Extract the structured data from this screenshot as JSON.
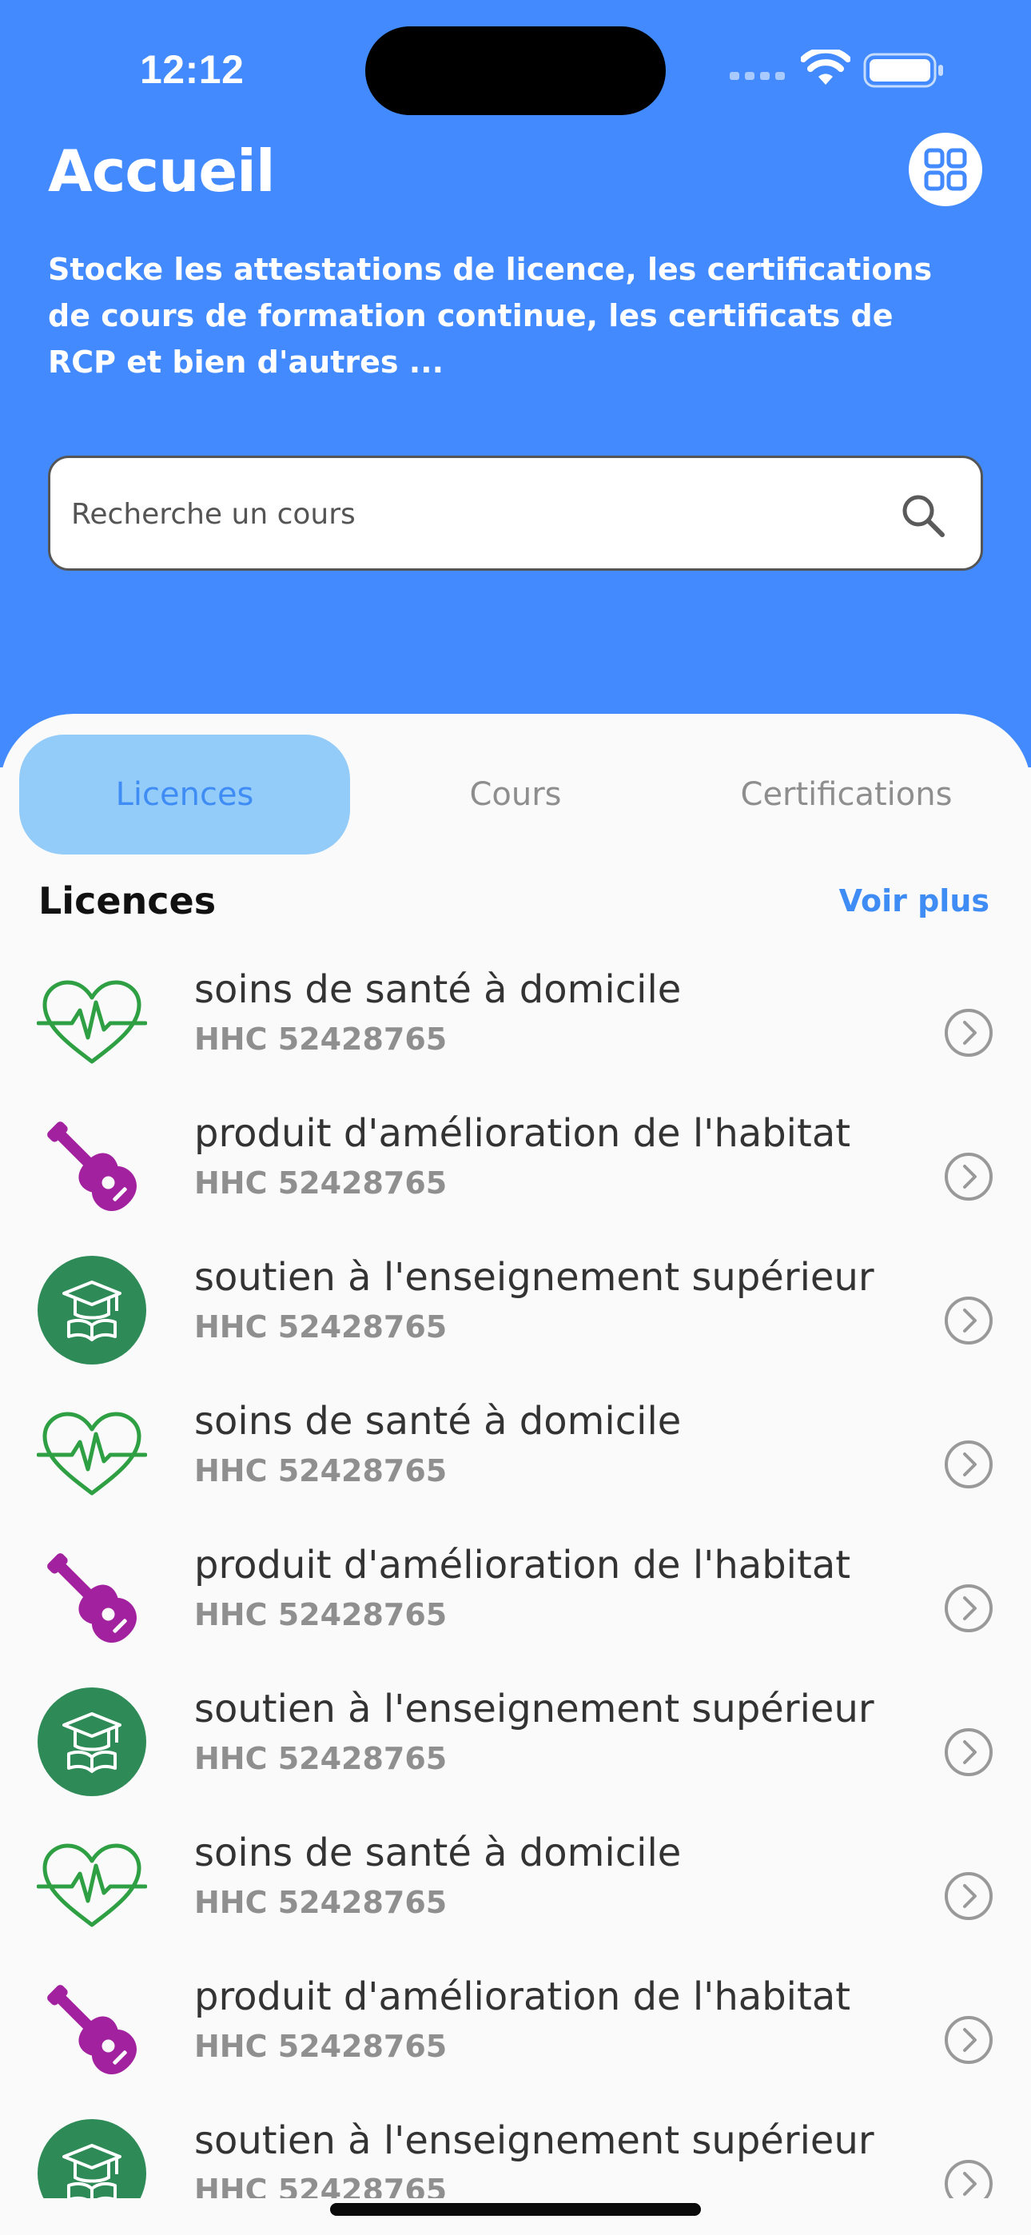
{
  "status_bar": {
    "time": "12:12"
  },
  "header": {
    "title": "Accueil",
    "description": "Stocke les attestations de licence, les certifications de cours de formation continue, les certificats de RCP et bien d'autres ..."
  },
  "search": {
    "placeholder": "Recherche un cours"
  },
  "tabs": [
    {
      "label": "Licences",
      "active": true
    },
    {
      "label": "Cours",
      "active": false
    },
    {
      "label": "Certifications",
      "active": false
    }
  ],
  "section": {
    "title": "Licences",
    "see_more": "Voir plus"
  },
  "items": [
    {
      "title": "soins de santé à domicile",
      "code": "HHC 52428765",
      "icon": "heart-pulse-icon"
    },
    {
      "title": "produit d'amélioration de l'habitat",
      "code": "HHC 52428765",
      "icon": "guitar-icon"
    },
    {
      "title": "soutien à l'enseignement supérieur",
      "code": "HHC 52428765",
      "icon": "graduation-cap-icon"
    },
    {
      "title": "soins de santé à domicile",
      "code": "HHC 52428765",
      "icon": "heart-pulse-icon"
    },
    {
      "title": "produit d'amélioration de l'habitat",
      "code": "HHC 52428765",
      "icon": "guitar-icon"
    },
    {
      "title": "soutien à l'enseignement supérieur",
      "code": "HHC 52428765",
      "icon": "graduation-cap-icon"
    },
    {
      "title": "soins de santé à domicile",
      "code": "HHC 52428765",
      "icon": "heart-pulse-icon"
    },
    {
      "title": "produit d'amélioration de l'habitat",
      "code": "HHC 52428765",
      "icon": "guitar-icon"
    },
    {
      "title": "soutien à l'enseignement supérieur",
      "code": "HHC 52428765",
      "icon": "graduation-cap-icon"
    }
  ],
  "colors": {
    "primary": "#428AFD",
    "tab_active_bg": "#93CBF9",
    "accent_text": "#3F8CF5",
    "heart_green": "#2EA043",
    "guitar_purple": "#A2219E",
    "cap_green": "#2E8B57"
  }
}
